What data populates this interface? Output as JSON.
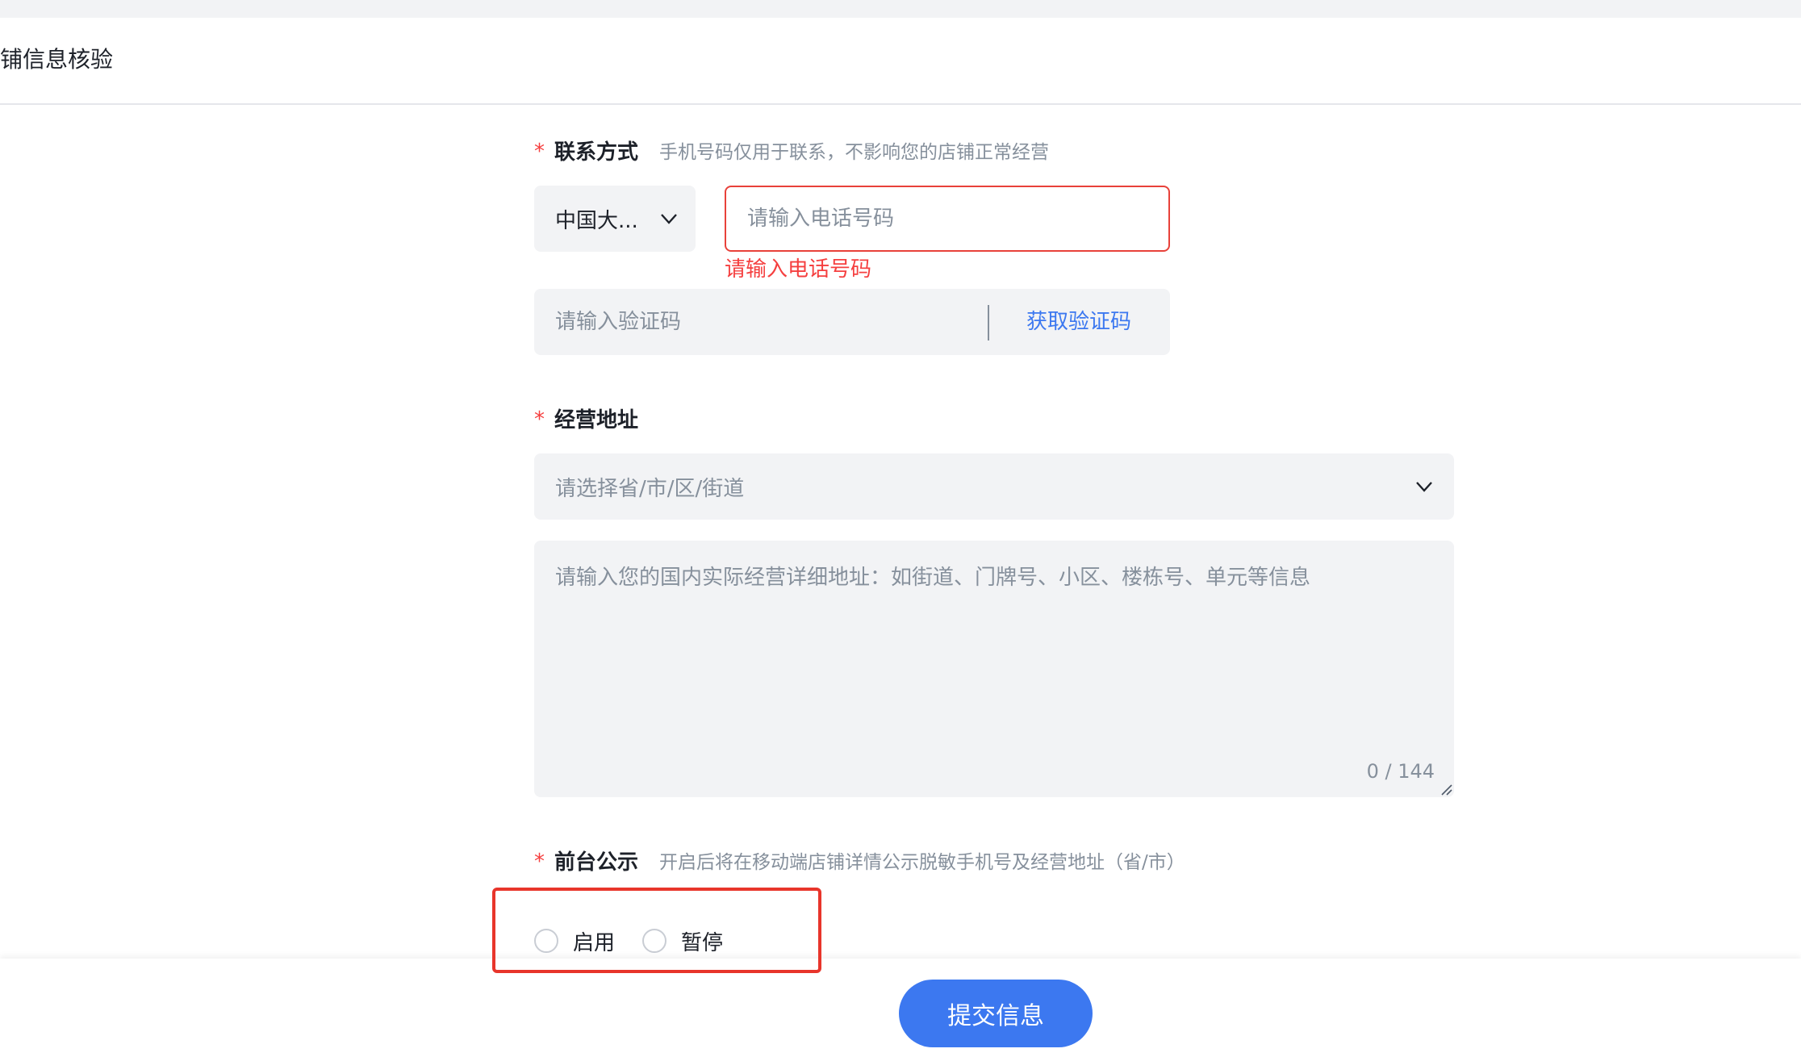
{
  "header": {
    "title": "铺信息核验"
  },
  "contact": {
    "required_mark": "*",
    "label": "联系方式",
    "hint": "手机号码仅用于联系，不影响您的店铺正常经营",
    "region": "中国大...",
    "phone_placeholder": "请输入电话号码",
    "phone_value": "",
    "phone_error": "请输入电话号码",
    "code_placeholder": "请输入验证码",
    "get_code_label": "获取验证码"
  },
  "address": {
    "required_mark": "*",
    "label": "经营地址",
    "region_placeholder": "请选择省/市/区/街道",
    "detail_placeholder": "请输入您的国内实际经营详细地址：如街道、门牌号、小区、楼栋号、单元等信息",
    "counter": "0 / 144"
  },
  "public_display": {
    "required_mark": "*",
    "label": "前台公示",
    "hint": "开启后将在移动端店铺详情公示脱敏手机号及经营地址（省/市）",
    "options": [
      {
        "label": "启用"
      },
      {
        "label": "暂停"
      }
    ]
  },
  "footer": {
    "submit_label": "提交信息"
  },
  "colors": {
    "primary": "#3c78f0",
    "error": "#f53f3f",
    "highlight": "#e8352b"
  },
  "icons": {
    "region_select": "chevron-down-icon",
    "address_picker": "chevron-down-icon",
    "textarea_resize": "resize-grip-icon"
  }
}
